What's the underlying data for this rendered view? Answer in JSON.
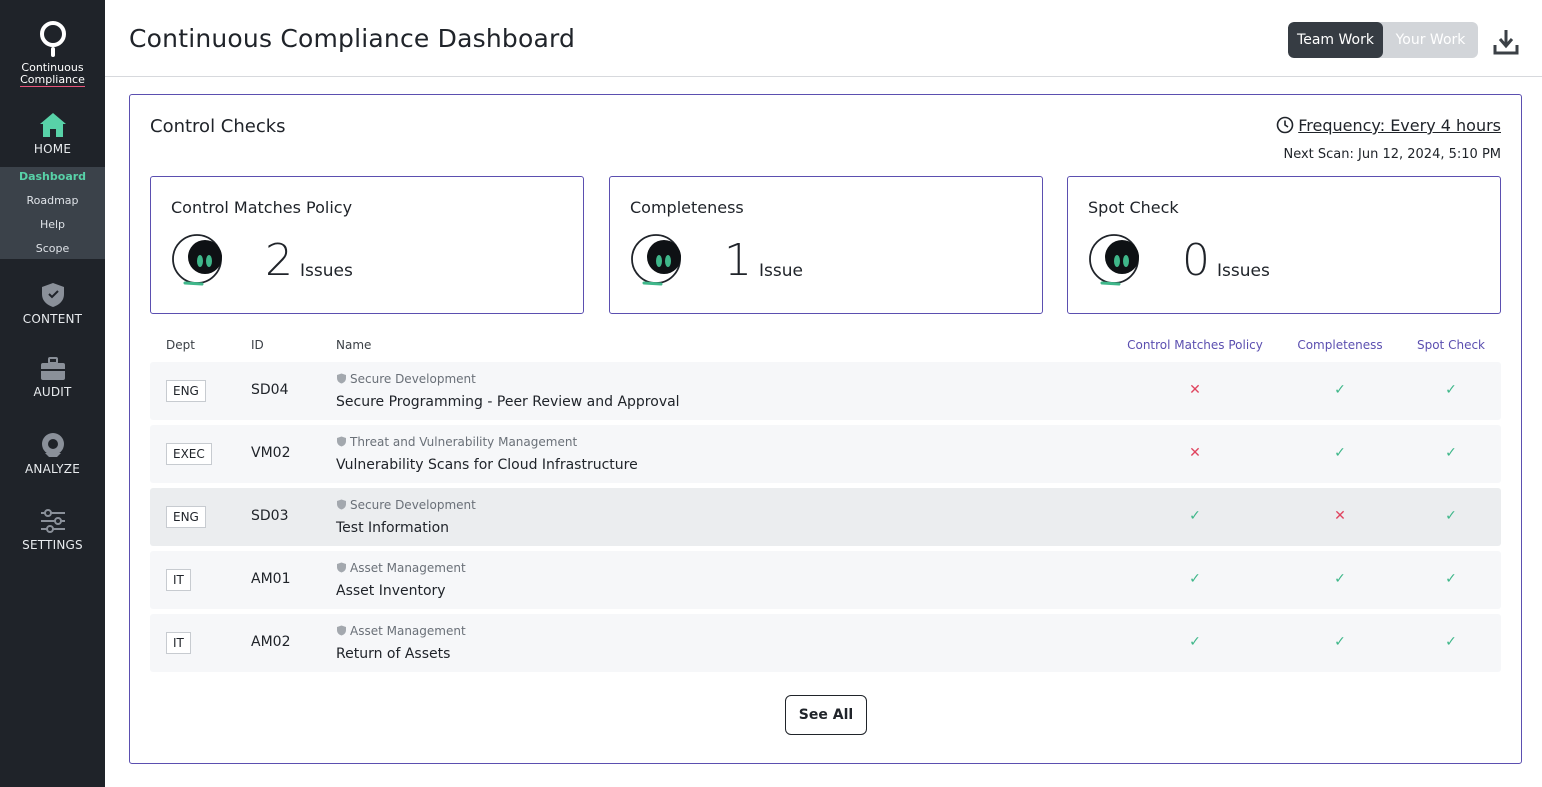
{
  "app": {
    "logo_line1": "Continuous",
    "logo_line2": "Compliance"
  },
  "sidebar": {
    "home": "HOME",
    "subnav": [
      "Dashboard",
      "Roadmap",
      "Help",
      "Scope"
    ],
    "content": "CONTENT",
    "audit": "AUDIT",
    "analyze": "ANALYZE",
    "settings": "SETTINGS"
  },
  "header": {
    "title": "Continuous Compliance Dashboard",
    "toggle_team": "Team Work",
    "toggle_your": "Your Work"
  },
  "panel": {
    "title": "Control Checks",
    "frequency": "Frequency: Every 4 hours",
    "next_scan": "Next Scan: Jun 12, 2024, 5:10 PM",
    "cards": [
      {
        "title": "Control Matches Policy",
        "count": "2",
        "unit": "Issues"
      },
      {
        "title": "Completeness",
        "count": "1",
        "unit": "Issue"
      },
      {
        "title": "Spot Check",
        "count": "0",
        "unit": "Issues"
      }
    ],
    "columns": {
      "dept": "Dept",
      "id": "ID",
      "name": "Name",
      "control": "Control Matches Policy",
      "completeness": "Completeness",
      "spot": "Spot Check"
    },
    "rows": [
      {
        "dept": "ENG",
        "id": "SD04",
        "category": "Secure Development",
        "name": "Secure Programming - Peer Review and Approval",
        "control": "✕",
        "completeness": "✓",
        "spot": "✓"
      },
      {
        "dept": "EXEC",
        "id": "VM02",
        "category": "Threat and Vulnerability Management",
        "name": "Vulnerability Scans for Cloud Infrastructure",
        "control": "✕",
        "completeness": "✓",
        "spot": "✓"
      },
      {
        "dept": "ENG",
        "id": "SD03",
        "category": "Secure Development",
        "name": "Test Information",
        "control": "✓",
        "completeness": "✕",
        "spot": "✓"
      },
      {
        "dept": "IT",
        "id": "AM01",
        "category": "Asset Management",
        "name": "Asset Inventory",
        "control": "✓",
        "completeness": "✓",
        "spot": "✓"
      },
      {
        "dept": "IT",
        "id": "AM02",
        "category": "Asset Management",
        "name": "Return of Assets",
        "control": "✓",
        "completeness": "✓",
        "spot": "✓"
      }
    ],
    "see_all": "See All"
  },
  "colors": {
    "accent": "#5b4fb0",
    "sidebar": "#1f2329",
    "ok": "#3fb78a",
    "bad": "#e0445f",
    "active_nav": "#58d2a8"
  }
}
